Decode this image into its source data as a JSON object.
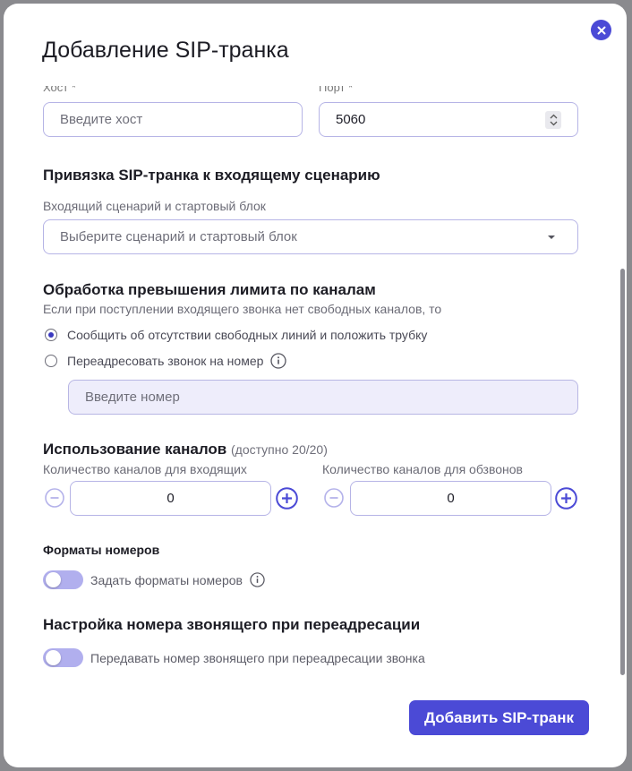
{
  "modal": {
    "title": "Добавление SIP-транка"
  },
  "host": {
    "label": "Хост *",
    "placeholder": "Введите хост"
  },
  "port": {
    "label": "Порт *",
    "value": "5060"
  },
  "binding": {
    "title": "Привязка SIP-транка к входящему сценарию",
    "field_label": "Входящий сценарий и стартовый блок",
    "placeholder": "Выберите сценарий и стартовый блок"
  },
  "overflow": {
    "title": "Обработка превышения лимита по каналам",
    "description": "Если при поступлении входящего звонка нет свободных каналов, то",
    "option_hangup": "Сообщить об отсутствии свободных линий и положить трубку",
    "option_forward": "Переадресовать звонок на номер",
    "selected": "hangup",
    "number_placeholder": "Введите номер"
  },
  "channels": {
    "title": "Использование каналов",
    "availability": "(доступно 20/20)",
    "incoming_label": "Количество каналов для входящих",
    "incoming_value": "0",
    "outbound_label": "Количество каналов для обзвонов",
    "outbound_value": "0"
  },
  "formats": {
    "title": "Форматы номеров",
    "toggle_label": "Задать форматы номеров",
    "enabled": false
  },
  "caller_id": {
    "title": "Настройка номера звонящего при переадресации",
    "toggle_label": "Передавать номер звонящего при переадресации звонка",
    "enabled": false
  },
  "actions": {
    "submit_label": "Добавить SIP-транк"
  },
  "colors": {
    "accent": "#4b4ad6",
    "toggle_off": "#b1afee",
    "input_border": "#b6b4e6"
  }
}
